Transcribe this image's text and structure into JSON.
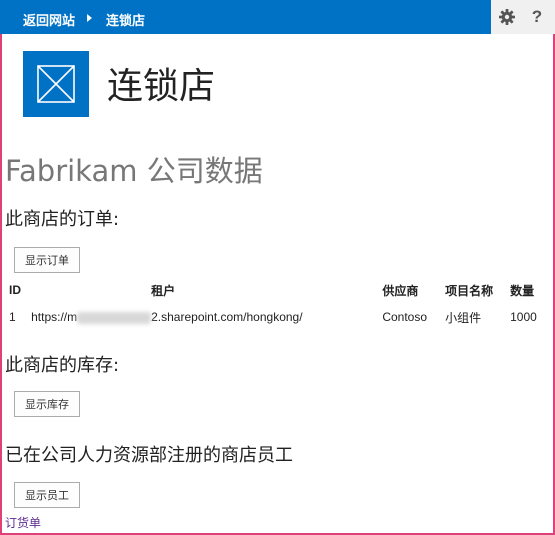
{
  "topbar": {
    "back_link": "返回网站",
    "site_link": "连锁店",
    "settings_icon": "gear-icon",
    "help_icon": "question-mark-icon",
    "help_glyph": "?"
  },
  "header": {
    "site_title": "连锁店",
    "logo_icon": "site-logo-icon"
  },
  "main": {
    "page_title": "Fabrikam 公司数据",
    "orders_heading": "此商店的订单:",
    "show_orders_button": "显示订单",
    "orders_table": {
      "columns": [
        "ID",
        "租户",
        "供应商",
        "项目名称",
        "数量"
      ],
      "rows": [
        {
          "id": "1",
          "tenant_prefix": "https://m",
          "tenant_suffix": "2.sharepoint.com/hongkong/",
          "vendor": "Contoso",
          "item": "小组件",
          "quantity": "1000"
        }
      ]
    },
    "inventory_heading": "此商店的库存:",
    "show_inventory_button": "显示库存",
    "employees_heading": "已在公司人力资源部注册的商店员工",
    "show_employees_button": "显示员工"
  },
  "footer": {
    "order_link": "订货单"
  },
  "colors": {
    "accent": "#0072c6",
    "frame": "#e0407a",
    "link_visited": "#5c2d91"
  }
}
